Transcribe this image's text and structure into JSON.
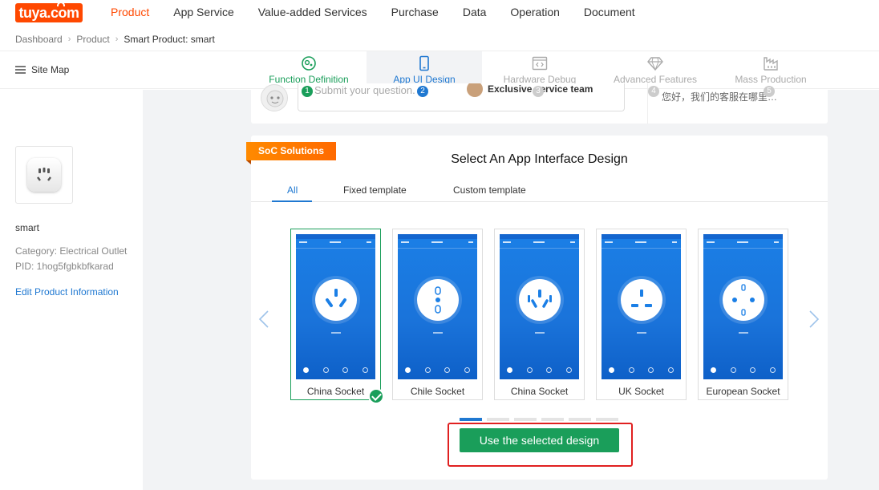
{
  "logo": {
    "text": "tuya.com"
  },
  "nav": {
    "items": [
      "Product",
      "App Service",
      "Value-added Services",
      "Purchase",
      "Data",
      "Operation",
      "Document"
    ],
    "active": "Product"
  },
  "breadcrumb": [
    "Dashboard",
    "Product",
    "Smart Product: smart"
  ],
  "sitemap": {
    "label": "Site Map"
  },
  "steps": [
    {
      "num": "1",
      "label": "Function Definition",
      "state": "done",
      "icon": "function-definition-icon"
    },
    {
      "num": "2",
      "label": "App UI Design",
      "state": "active",
      "icon": "phone-icon"
    },
    {
      "num": "3",
      "label": "Hardware Debug",
      "state": "todo",
      "icon": "code-icon"
    },
    {
      "num": "4",
      "label": "Advanced Features",
      "state": "todo",
      "icon": "diamond-icon"
    },
    {
      "num": "5",
      "label": "Mass Production",
      "state": "todo",
      "icon": "factory-icon"
    }
  ],
  "product": {
    "name": "smart",
    "category": "Category: Electrical Outlet",
    "pid": "PID: 1hog5fgbkbfkarad",
    "edit_link": "Edit Product Information"
  },
  "help": {
    "placeholder": "Submit your question.",
    "service_team": "Exclusive service team",
    "chat": "您好，我们的客服在哪里…"
  },
  "badge": "SoC Solutions",
  "title": "Select An App Interface Design",
  "tabs": [
    "All",
    "Fixed template",
    "Custom template"
  ],
  "active_tab": "All",
  "templates": [
    {
      "name": "China Socket",
      "selected": true
    },
    {
      "name": "Chile Socket",
      "selected": false
    },
    {
      "name": "China Socket",
      "selected": false
    },
    {
      "name": "UK Socket",
      "selected": false
    },
    {
      "name": "European Socket",
      "selected": false
    }
  ],
  "pager": {
    "count": 6,
    "active_index": 0
  },
  "action_button": "Use the selected design",
  "colors": {
    "brand": "#ff4800",
    "primary": "#1f78d1",
    "success": "#1a9e5a",
    "highlight": "#e02020",
    "phone_bg": "#1b7fe6"
  }
}
